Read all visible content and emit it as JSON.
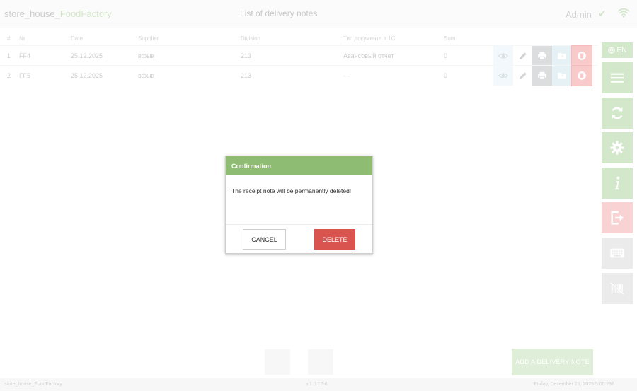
{
  "header": {
    "app_name_prefix": "store_house_",
    "app_name_brand": "FoodFactory",
    "page_title": "List of delivery notes",
    "user": "Admin"
  },
  "table": {
    "columns": [
      "#",
      "№",
      "Date",
      "Supplier",
      "Division",
      "Тип документа в 1С",
      "Sum"
    ],
    "rows": [
      [
        "1",
        "FF4",
        "25.12.2025",
        "вфыв",
        "213",
        "Авансовый отчет",
        "0"
      ],
      [
        "2",
        "FF5",
        "25.12.2025",
        "вфыв",
        "213",
        "—",
        "0"
      ]
    ]
  },
  "sidebar": {
    "lang": "EN",
    "buttons": [
      "menu-icon",
      "sync-icon",
      "settings-icon",
      "info-icon",
      "logout-icon",
      "keyboard-icon",
      "barcode-off-icon"
    ]
  },
  "bottom": {
    "add_note": "ADD A DELIVERY NOTE"
  },
  "footer": {
    "app_id": "store_house_FoodFactory",
    "version": "v.1.0.12-6",
    "datetime": "Friday, December 26, 2025 5:00 PM"
  },
  "dialog": {
    "title": "Confirmation",
    "message": "The receipt note will be permanently deleted!",
    "cancel_label": "CANCEL",
    "delete_label": "DELETE"
  },
  "colors": {
    "accent_green": "#8fbc73",
    "danger_red": "#d9534f"
  }
}
